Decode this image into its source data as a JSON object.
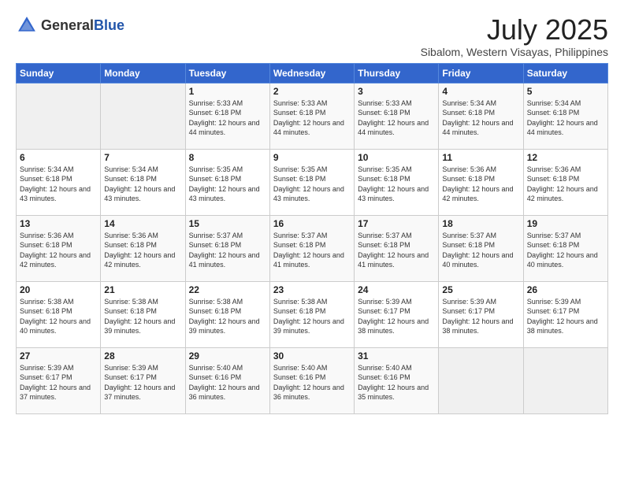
{
  "header": {
    "logo_general": "General",
    "logo_blue": "Blue",
    "month_title": "July 2025",
    "subtitle": "Sibalom, Western Visayas, Philippines"
  },
  "days_of_week": [
    "Sunday",
    "Monday",
    "Tuesday",
    "Wednesday",
    "Thursday",
    "Friday",
    "Saturday"
  ],
  "weeks": [
    [
      {
        "day": "",
        "info": ""
      },
      {
        "day": "",
        "info": ""
      },
      {
        "day": "1",
        "info": "Sunrise: 5:33 AM\nSunset: 6:18 PM\nDaylight: 12 hours and 44 minutes."
      },
      {
        "day": "2",
        "info": "Sunrise: 5:33 AM\nSunset: 6:18 PM\nDaylight: 12 hours and 44 minutes."
      },
      {
        "day": "3",
        "info": "Sunrise: 5:33 AM\nSunset: 6:18 PM\nDaylight: 12 hours and 44 minutes."
      },
      {
        "day": "4",
        "info": "Sunrise: 5:34 AM\nSunset: 6:18 PM\nDaylight: 12 hours and 44 minutes."
      },
      {
        "day": "5",
        "info": "Sunrise: 5:34 AM\nSunset: 6:18 PM\nDaylight: 12 hours and 44 minutes."
      }
    ],
    [
      {
        "day": "6",
        "info": "Sunrise: 5:34 AM\nSunset: 6:18 PM\nDaylight: 12 hours and 43 minutes."
      },
      {
        "day": "7",
        "info": "Sunrise: 5:34 AM\nSunset: 6:18 PM\nDaylight: 12 hours and 43 minutes."
      },
      {
        "day": "8",
        "info": "Sunrise: 5:35 AM\nSunset: 6:18 PM\nDaylight: 12 hours and 43 minutes."
      },
      {
        "day": "9",
        "info": "Sunrise: 5:35 AM\nSunset: 6:18 PM\nDaylight: 12 hours and 43 minutes."
      },
      {
        "day": "10",
        "info": "Sunrise: 5:35 AM\nSunset: 6:18 PM\nDaylight: 12 hours and 43 minutes."
      },
      {
        "day": "11",
        "info": "Sunrise: 5:36 AM\nSunset: 6:18 PM\nDaylight: 12 hours and 42 minutes."
      },
      {
        "day": "12",
        "info": "Sunrise: 5:36 AM\nSunset: 6:18 PM\nDaylight: 12 hours and 42 minutes."
      }
    ],
    [
      {
        "day": "13",
        "info": "Sunrise: 5:36 AM\nSunset: 6:18 PM\nDaylight: 12 hours and 42 minutes."
      },
      {
        "day": "14",
        "info": "Sunrise: 5:36 AM\nSunset: 6:18 PM\nDaylight: 12 hours and 42 minutes."
      },
      {
        "day": "15",
        "info": "Sunrise: 5:37 AM\nSunset: 6:18 PM\nDaylight: 12 hours and 41 minutes."
      },
      {
        "day": "16",
        "info": "Sunrise: 5:37 AM\nSunset: 6:18 PM\nDaylight: 12 hours and 41 minutes."
      },
      {
        "day": "17",
        "info": "Sunrise: 5:37 AM\nSunset: 6:18 PM\nDaylight: 12 hours and 41 minutes."
      },
      {
        "day": "18",
        "info": "Sunrise: 5:37 AM\nSunset: 6:18 PM\nDaylight: 12 hours and 40 minutes."
      },
      {
        "day": "19",
        "info": "Sunrise: 5:37 AM\nSunset: 6:18 PM\nDaylight: 12 hours and 40 minutes."
      }
    ],
    [
      {
        "day": "20",
        "info": "Sunrise: 5:38 AM\nSunset: 6:18 PM\nDaylight: 12 hours and 40 minutes."
      },
      {
        "day": "21",
        "info": "Sunrise: 5:38 AM\nSunset: 6:18 PM\nDaylight: 12 hours and 39 minutes."
      },
      {
        "day": "22",
        "info": "Sunrise: 5:38 AM\nSunset: 6:18 PM\nDaylight: 12 hours and 39 minutes."
      },
      {
        "day": "23",
        "info": "Sunrise: 5:38 AM\nSunset: 6:18 PM\nDaylight: 12 hours and 39 minutes."
      },
      {
        "day": "24",
        "info": "Sunrise: 5:39 AM\nSunset: 6:17 PM\nDaylight: 12 hours and 38 minutes."
      },
      {
        "day": "25",
        "info": "Sunrise: 5:39 AM\nSunset: 6:17 PM\nDaylight: 12 hours and 38 minutes."
      },
      {
        "day": "26",
        "info": "Sunrise: 5:39 AM\nSunset: 6:17 PM\nDaylight: 12 hours and 38 minutes."
      }
    ],
    [
      {
        "day": "27",
        "info": "Sunrise: 5:39 AM\nSunset: 6:17 PM\nDaylight: 12 hours and 37 minutes."
      },
      {
        "day": "28",
        "info": "Sunrise: 5:39 AM\nSunset: 6:17 PM\nDaylight: 12 hours and 37 minutes."
      },
      {
        "day": "29",
        "info": "Sunrise: 5:40 AM\nSunset: 6:16 PM\nDaylight: 12 hours and 36 minutes."
      },
      {
        "day": "30",
        "info": "Sunrise: 5:40 AM\nSunset: 6:16 PM\nDaylight: 12 hours and 36 minutes."
      },
      {
        "day": "31",
        "info": "Sunrise: 5:40 AM\nSunset: 6:16 PM\nDaylight: 12 hours and 35 minutes."
      },
      {
        "day": "",
        "info": ""
      },
      {
        "day": "",
        "info": ""
      }
    ]
  ]
}
